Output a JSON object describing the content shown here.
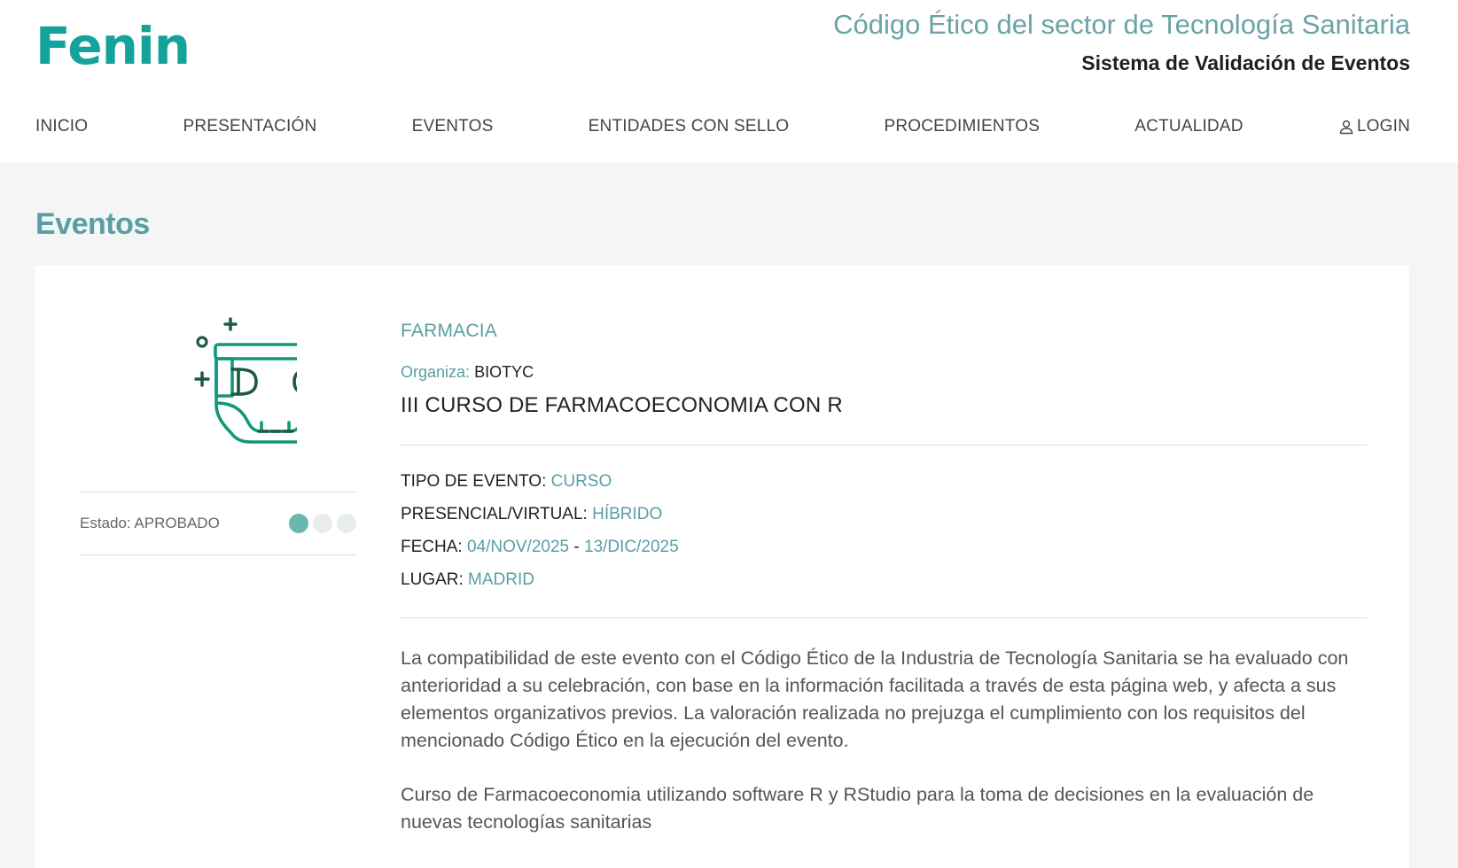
{
  "header": {
    "logo": "Fenin",
    "title": "Código Ético del sector de Tecnología Sanitaria",
    "subtitle": "Sistema de Validación de Eventos"
  },
  "nav": {
    "items": [
      "INICIO",
      "PRESENTACIÓN",
      "EVENTOS",
      "ENTIDADES CON SELLO",
      "PROCEDIMIENTOS",
      "ACTUALIDAD"
    ],
    "login": "LOGIN",
    "login_icon": "user-icon"
  },
  "page": {
    "title": "Eventos"
  },
  "event": {
    "icon": "diaper-icon",
    "status": "Estado: APROBADO",
    "status_step": 1,
    "status_steps_total": 3,
    "category": "FARMACIA",
    "organizer_label": "Organiza:",
    "organizer": "BIOTYC",
    "name": "III CURSO DE FARMACOECONOMIA CON R",
    "type_label": "TIPO DE EVENTO:",
    "type": "CURSO",
    "mode_label": "PRESENCIAL/VIRTUAL:",
    "mode": "HÍBRIDO",
    "date_label": "FECHA:",
    "date_start": "04/NOV/2025",
    "date_sep": "-",
    "date_end": "13/DIC/2025",
    "place_label": "LUGAR:",
    "place": "MADRID",
    "disclaimer": "La compatibilidad de este evento con el Código Ético de la Industria de Tecnología Sanitaria se ha evaluado con anterioridad a su celebración, con base en la información facilitada a través de esta página web, y afecta a sus elementos organizativos previos. La valoración realizada no prejuzga el cumplimiento con los requisitos del mencionado Código Ético en la ejecución del evento.",
    "description": "Curso de Farmacoeconomia utilizando software R y RStudio para la toma de decisiones en la evaluación de nuevas tecnologías sanitarias"
  },
  "colors": {
    "brand": "#13a39a",
    "accent": "#5a9ea3",
    "status_active": "#6bb7ad",
    "status_inactive": "#e9ecec"
  }
}
